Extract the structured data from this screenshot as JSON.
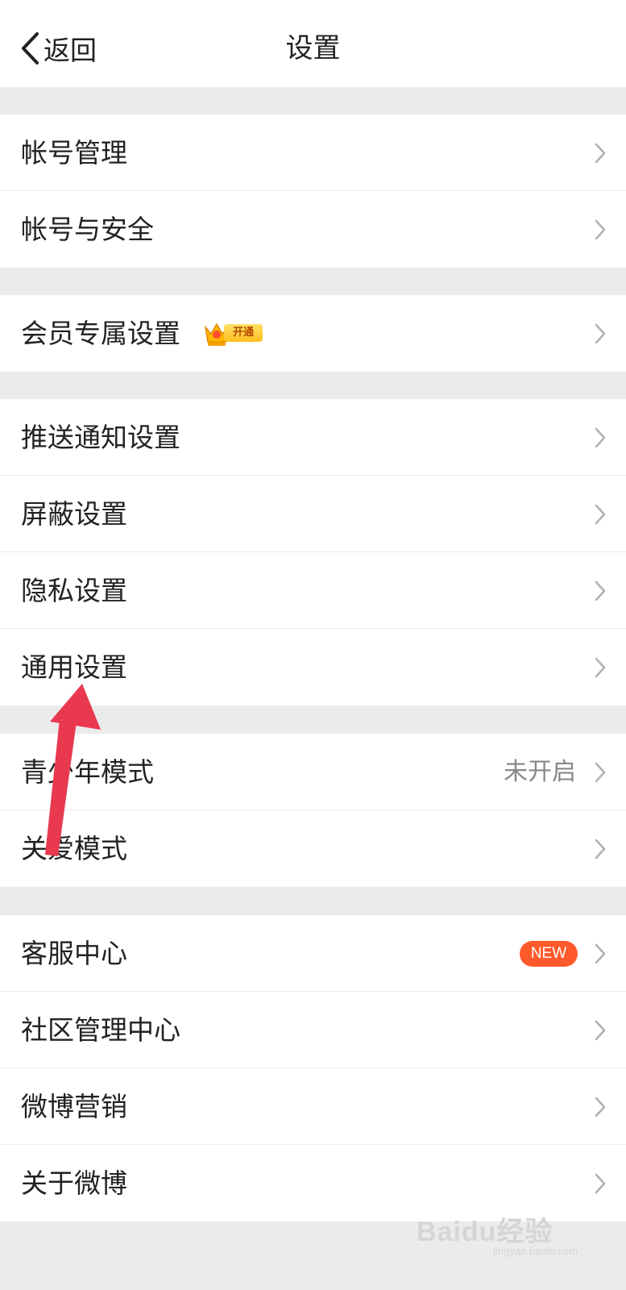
{
  "header": {
    "back_label": "返回",
    "title": "设置"
  },
  "groups": [
    [
      {
        "label": "帐号管理"
      },
      {
        "label": "帐号与安全"
      }
    ],
    [
      {
        "label": "会员专属设置",
        "badge": "开通"
      }
    ],
    [
      {
        "label": "推送通知设置"
      },
      {
        "label": "屏蔽设置"
      },
      {
        "label": "隐私设置"
      },
      {
        "label": "通用设置"
      }
    ],
    [
      {
        "label": "青少年模式",
        "value": "未开启"
      },
      {
        "label": "关爱模式"
      }
    ],
    [
      {
        "label": "客服中心",
        "badge": "NEW"
      },
      {
        "label": "社区管理中心"
      },
      {
        "label": "微博营销"
      },
      {
        "label": "关于微博"
      }
    ]
  ],
  "colors": {
    "accent_arrow": "#e8394f",
    "new_badge": "#ff5a2c",
    "background": "#ebebeb"
  },
  "icons": {
    "back": "chevron-left-icon",
    "row_nav": "chevron-right-icon",
    "vip": "crown-icon",
    "annotation": "red-arrow-icon"
  },
  "watermark": {
    "logo": "Baidu经验",
    "site": "jingyan.baidu.com"
  }
}
